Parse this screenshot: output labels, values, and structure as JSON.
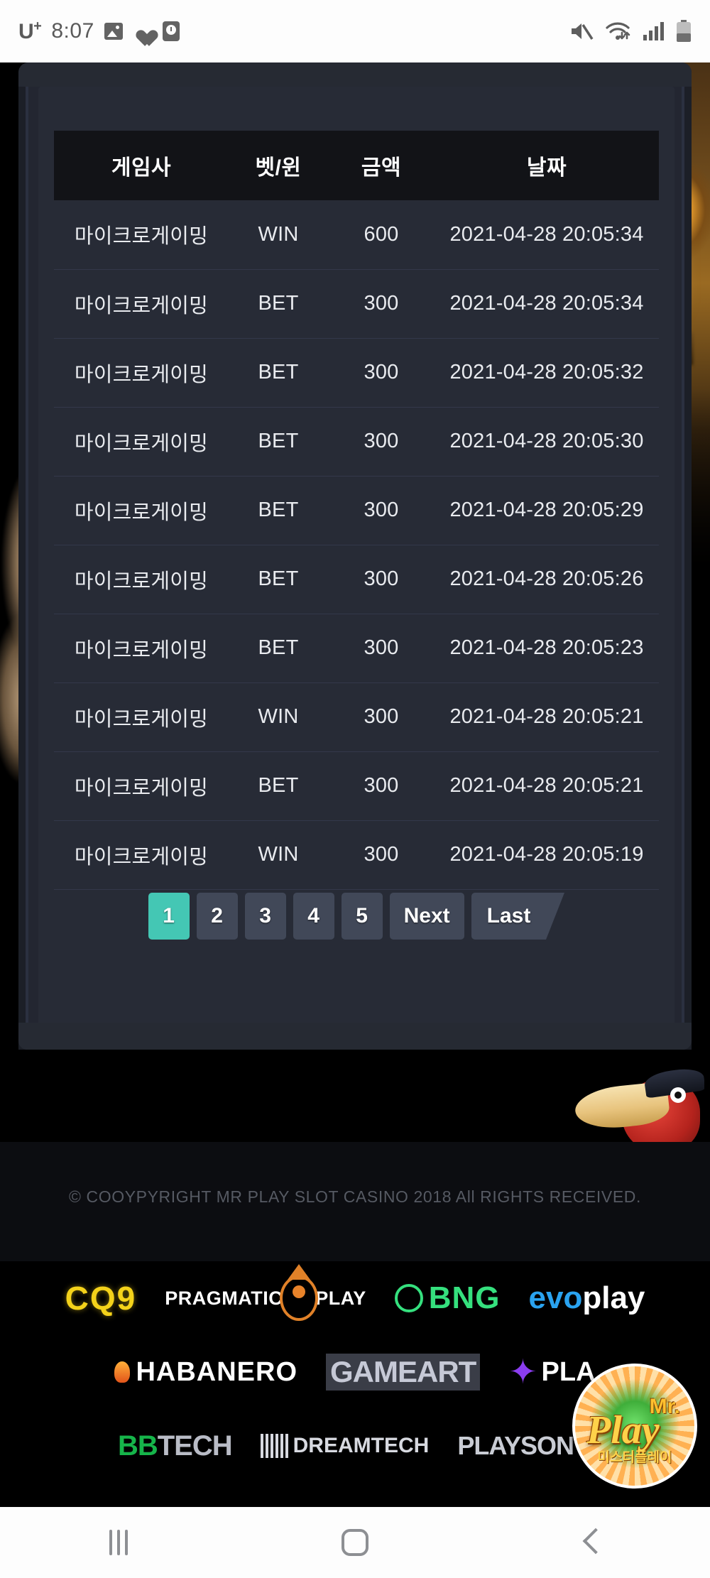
{
  "status_bar": {
    "carrier": "U",
    "carrier_sup": "+",
    "time": "8:07",
    "icons": [
      "photo-icon",
      "heart-icon",
      "alarm-icon",
      "mute-icon",
      "wifi-icon",
      "signal-icon",
      "battery-icon"
    ]
  },
  "table": {
    "headers": {
      "game_provider": "게임사",
      "bet_win": "벳/윈",
      "amount": "금액",
      "date": "날짜"
    },
    "amount_color": "#3fc9b4",
    "rows": [
      {
        "provider": "마이크로게이밍",
        "type": "WIN",
        "amount": "600",
        "date": "2021-04-28 20:05:34"
      },
      {
        "provider": "마이크로게이밍",
        "type": "BET",
        "amount": "300",
        "date": "2021-04-28 20:05:34"
      },
      {
        "provider": "마이크로게이밍",
        "type": "BET",
        "amount": "300",
        "date": "2021-04-28 20:05:32"
      },
      {
        "provider": "마이크로게이밍",
        "type": "BET",
        "amount": "300",
        "date": "2021-04-28 20:05:30"
      },
      {
        "provider": "마이크로게이밍",
        "type": "BET",
        "amount": "300",
        "date": "2021-04-28 20:05:29"
      },
      {
        "provider": "마이크로게이밍",
        "type": "BET",
        "amount": "300",
        "date": "2021-04-28 20:05:26"
      },
      {
        "provider": "마이크로게이밍",
        "type": "BET",
        "amount": "300",
        "date": "2021-04-28 20:05:23"
      },
      {
        "provider": "마이크로게이밍",
        "type": "WIN",
        "amount": "300",
        "date": "2021-04-28 20:05:21"
      },
      {
        "provider": "마이크로게이밍",
        "type": "BET",
        "amount": "300",
        "date": "2021-04-28 20:05:21"
      },
      {
        "provider": "마이크로게이밍",
        "type": "WIN",
        "amount": "300",
        "date": "2021-04-28 20:05:19"
      }
    ]
  },
  "pagination": {
    "active_page": "1",
    "active_color": "#44c7b4",
    "pages": [
      "1",
      "2",
      "3",
      "4",
      "5"
    ],
    "next_label": "Next",
    "last_label": "Last"
  },
  "footer": {
    "copyright": "© COOYPYRIGHT MR PLAY SLOT CASINO 2018 All RIGHTS RECEIVED.",
    "logos_row1": [
      "CQ9",
      "PRAGMATIC",
      "PLAY",
      "BNG",
      "evo",
      "play"
    ],
    "logos_row2": [
      "HABANERO",
      "GAMEART",
      "PLA"
    ],
    "logos_row3": [
      "BB",
      "TECH",
      "DREAMTECH",
      "PLAYSON"
    ]
  },
  "badge": {
    "mr": "Mr.",
    "play": "Play",
    "korean": "미스터플레이"
  },
  "navbar": {
    "recents": "recents-icon",
    "home": "home-icon",
    "back": "back-icon"
  }
}
